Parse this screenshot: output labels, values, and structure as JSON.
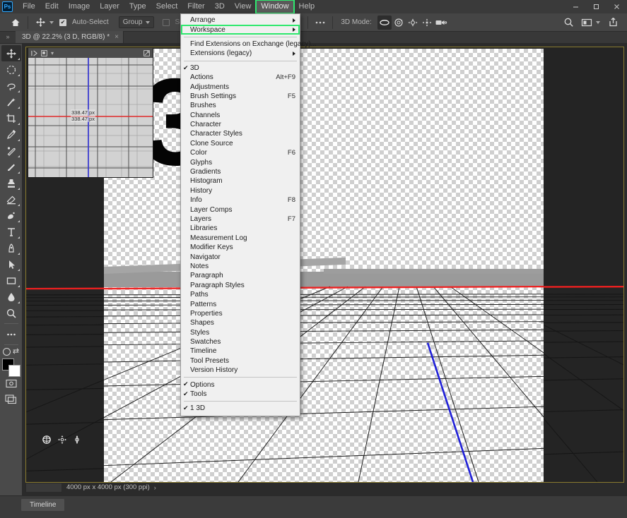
{
  "app": {
    "logo": "ps-logo",
    "title": "Adobe Photoshop"
  },
  "menubar": {
    "items": [
      {
        "label": "File",
        "active": false
      },
      {
        "label": "Edit",
        "active": false
      },
      {
        "label": "Image",
        "active": false
      },
      {
        "label": "Layer",
        "active": false
      },
      {
        "label": "Type",
        "active": false
      },
      {
        "label": "Select",
        "active": false
      },
      {
        "label": "Filter",
        "active": false
      },
      {
        "label": "3D",
        "active": false
      },
      {
        "label": "View",
        "active": false
      },
      {
        "label": "Window",
        "active": true
      },
      {
        "label": "Help",
        "active": false
      }
    ],
    "highlight_color": "#2ee86e"
  },
  "window_controls": {
    "minimize": "minimize-icon",
    "maximize": "maximize-icon",
    "close": "close-icon"
  },
  "options_bar": {
    "home_icon": "home-icon",
    "tool_icon": "move-tool-icon",
    "auto_select": {
      "label": "Auto-Select",
      "checked": true
    },
    "group_dropdown": {
      "value": "Group"
    },
    "show_transform": {
      "label": "Show Transform Controls",
      "checked": false,
      "enabled": false
    },
    "align_left_icon": "align-left-icon",
    "align_center_icon": "align-center-icon",
    "more_icon": "more-options-icon",
    "mode_label": "3D Mode:",
    "mode_tools": [
      {
        "name": "orbit-3d-icon",
        "selected": true
      },
      {
        "name": "roll-3d-icon",
        "selected": false
      },
      {
        "name": "pan-3d-icon",
        "selected": false
      },
      {
        "name": "slide-3d-icon",
        "selected": false
      },
      {
        "name": "zoom-camera-3d-icon",
        "selected": false
      }
    ],
    "search_icon": "search-icon",
    "arrange_icon": "arrange-documents-icon",
    "share_icon": "share-icon"
  },
  "document_tab": {
    "title": "3D @ 22.2% (3 D, RGB/8) *",
    "close": "×",
    "collapse_icon": "collapse-arrows-icon"
  },
  "tools": [
    {
      "name": "move-tool",
      "glyph": "move",
      "selected": true,
      "has_corner": true
    },
    {
      "name": "elliptical-marquee-tool",
      "glyph": "ellipse",
      "selected": false,
      "has_corner": true
    },
    {
      "name": "lasso-tool",
      "glyph": "lasso",
      "selected": false,
      "has_corner": true
    },
    {
      "name": "object-selection-tool",
      "glyph": "wand",
      "selected": false,
      "has_corner": true
    },
    {
      "name": "crop-tool",
      "glyph": "crop",
      "selected": false,
      "has_corner": true
    },
    {
      "name": "eyedropper-tool",
      "glyph": "eyedropper",
      "selected": false,
      "has_corner": true
    },
    {
      "name": "spot-healing-brush-tool",
      "glyph": "heal",
      "selected": false,
      "has_corner": true
    },
    {
      "name": "brush-tool",
      "glyph": "brush",
      "selected": false,
      "has_corner": true
    },
    {
      "name": "clone-stamp-tool",
      "glyph": "stamp",
      "selected": false,
      "has_corner": true
    },
    {
      "name": "eraser-tool",
      "glyph": "eraser",
      "selected": false,
      "has_corner": true
    },
    {
      "name": "gradient-tool",
      "glyph": "gradient",
      "selected": false,
      "has_corner": true
    },
    {
      "name": "type-tool",
      "glyph": "type",
      "selected": false,
      "has_corner": true
    },
    {
      "name": "pen-tool",
      "glyph": "pen",
      "selected": false,
      "has_corner": true
    },
    {
      "name": "path-selection-tool",
      "glyph": "arrow",
      "selected": false,
      "has_corner": true
    },
    {
      "name": "rectangle-tool",
      "glyph": "rectangle",
      "selected": false,
      "has_corner": true
    },
    {
      "name": "blur-tool",
      "glyph": "blur",
      "selected": false,
      "has_corner": true
    },
    {
      "name": "zoom-tool",
      "glyph": "zoom",
      "selected": false,
      "has_corner": false
    },
    {
      "name": "edit-toolbar-button",
      "glyph": "ellipsis",
      "selected": false,
      "has_corner": false
    }
  ],
  "tool_footer": {
    "foreground_color": "#000000",
    "background_color": "#ffffff",
    "swap_icon": "swap-colors-icon",
    "default_icon": "default-colors-icon",
    "quickmask_icon": "quick-mask-icon",
    "screenmode_icon": "screen-mode-icon"
  },
  "navigator_panel": {
    "tab_icon_1": "info-panel-icon",
    "tab_icon_2": "navigator-panel-icon",
    "menu_icon": "panel-menu-icon",
    "expand_icon": "expand-panel-icon",
    "measure_label_1": "338.47 px",
    "measure_label_2": "338.47 px",
    "guide_vertical_color": "#3a3ad0",
    "guide_horizontal_color": "#e02a2a"
  },
  "canvas": {
    "text_3d": "3D",
    "horizon_line_color": "#ee2020",
    "axis_line_color": "#2020d8",
    "ground_color": "#9a9a9a",
    "widget_icons": [
      "rotate-3d-widget-icon",
      "pan-3d-widget-icon",
      "scale-3d-widget-icon"
    ]
  },
  "status_bar": {
    "zoom_value": "",
    "doc_size": "4000 px x 4000 px (300 ppi)",
    "arrow": "›"
  },
  "timeline_panel": {
    "tab_label": "Timeline"
  },
  "window_menu": {
    "items": [
      {
        "label": "Arrange",
        "submenu": true,
        "checked": false,
        "accel": "",
        "highlight": false,
        "separator_after": false
      },
      {
        "label": "Workspace",
        "submenu": true,
        "checked": false,
        "accel": "",
        "highlight": true,
        "separator_after": true
      },
      {
        "label": "Find Extensions on Exchange (legacy)...",
        "submenu": false,
        "checked": false,
        "accel": "",
        "highlight": false,
        "separator_after": false
      },
      {
        "label": "Extensions (legacy)",
        "submenu": true,
        "checked": false,
        "accel": "",
        "highlight": false,
        "separator_after": true
      },
      {
        "label": "3D",
        "submenu": false,
        "checked": true,
        "accel": "",
        "highlight": false,
        "separator_after": false
      },
      {
        "label": "Actions",
        "submenu": false,
        "checked": false,
        "accel": "Alt+F9",
        "highlight": false,
        "separator_after": false
      },
      {
        "label": "Adjustments",
        "submenu": false,
        "checked": false,
        "accel": "",
        "highlight": false,
        "separator_after": false
      },
      {
        "label": "Brush Settings",
        "submenu": false,
        "checked": false,
        "accel": "F5",
        "highlight": false,
        "separator_after": false
      },
      {
        "label": "Brushes",
        "submenu": false,
        "checked": false,
        "accel": "",
        "highlight": false,
        "separator_after": false
      },
      {
        "label": "Channels",
        "submenu": false,
        "checked": false,
        "accel": "",
        "highlight": false,
        "separator_after": false
      },
      {
        "label": "Character",
        "submenu": false,
        "checked": false,
        "accel": "",
        "highlight": false,
        "separator_after": false
      },
      {
        "label": "Character Styles",
        "submenu": false,
        "checked": false,
        "accel": "",
        "highlight": false,
        "separator_after": false
      },
      {
        "label": "Clone Source",
        "submenu": false,
        "checked": false,
        "accel": "",
        "highlight": false,
        "separator_after": false
      },
      {
        "label": "Color",
        "submenu": false,
        "checked": false,
        "accel": "F6",
        "highlight": false,
        "separator_after": false
      },
      {
        "label": "Glyphs",
        "submenu": false,
        "checked": false,
        "accel": "",
        "highlight": false,
        "separator_after": false
      },
      {
        "label": "Gradients",
        "submenu": false,
        "checked": false,
        "accel": "",
        "highlight": false,
        "separator_after": false
      },
      {
        "label": "Histogram",
        "submenu": false,
        "checked": false,
        "accel": "",
        "highlight": false,
        "separator_after": false
      },
      {
        "label": "History",
        "submenu": false,
        "checked": false,
        "accel": "",
        "highlight": false,
        "separator_after": false
      },
      {
        "label": "Info",
        "submenu": false,
        "checked": false,
        "accel": "F8",
        "highlight": false,
        "separator_after": false
      },
      {
        "label": "Layer Comps",
        "submenu": false,
        "checked": false,
        "accel": "",
        "highlight": false,
        "separator_after": false
      },
      {
        "label": "Layers",
        "submenu": false,
        "checked": false,
        "accel": "F7",
        "highlight": false,
        "separator_after": false
      },
      {
        "label": "Libraries",
        "submenu": false,
        "checked": false,
        "accel": "",
        "highlight": false,
        "separator_after": false
      },
      {
        "label": "Measurement Log",
        "submenu": false,
        "checked": false,
        "accel": "",
        "highlight": false,
        "separator_after": false
      },
      {
        "label": "Modifier Keys",
        "submenu": false,
        "checked": false,
        "accel": "",
        "highlight": false,
        "separator_after": false
      },
      {
        "label": "Navigator",
        "submenu": false,
        "checked": false,
        "accel": "",
        "highlight": false,
        "separator_after": false
      },
      {
        "label": "Notes",
        "submenu": false,
        "checked": false,
        "accel": "",
        "highlight": false,
        "separator_after": false
      },
      {
        "label": "Paragraph",
        "submenu": false,
        "checked": false,
        "accel": "",
        "highlight": false,
        "separator_after": false
      },
      {
        "label": "Paragraph Styles",
        "submenu": false,
        "checked": false,
        "accel": "",
        "highlight": false,
        "separator_after": false
      },
      {
        "label": "Paths",
        "submenu": false,
        "checked": false,
        "accel": "",
        "highlight": false,
        "separator_after": false
      },
      {
        "label": "Patterns",
        "submenu": false,
        "checked": false,
        "accel": "",
        "highlight": false,
        "separator_after": false
      },
      {
        "label": "Properties",
        "submenu": false,
        "checked": false,
        "accel": "",
        "highlight": false,
        "separator_after": false
      },
      {
        "label": "Shapes",
        "submenu": false,
        "checked": false,
        "accel": "",
        "highlight": false,
        "separator_after": false
      },
      {
        "label": "Styles",
        "submenu": false,
        "checked": false,
        "accel": "",
        "highlight": false,
        "separator_after": false
      },
      {
        "label": "Swatches",
        "submenu": false,
        "checked": false,
        "accel": "",
        "highlight": false,
        "separator_after": false
      },
      {
        "label": "Timeline",
        "submenu": false,
        "checked": false,
        "accel": "",
        "highlight": false,
        "separator_after": false
      },
      {
        "label": "Tool Presets",
        "submenu": false,
        "checked": false,
        "accel": "",
        "highlight": false,
        "separator_after": false
      },
      {
        "label": "Version History",
        "submenu": false,
        "checked": false,
        "accel": "",
        "highlight": false,
        "separator_after": true
      },
      {
        "label": "Options",
        "submenu": false,
        "checked": true,
        "accel": "",
        "highlight": false,
        "separator_after": false
      },
      {
        "label": "Tools",
        "submenu": false,
        "checked": true,
        "accel": "",
        "highlight": false,
        "separator_after": true
      },
      {
        "label": "1 3D",
        "submenu": false,
        "checked": true,
        "accel": "",
        "highlight": false,
        "separator_after": false
      }
    ]
  }
}
